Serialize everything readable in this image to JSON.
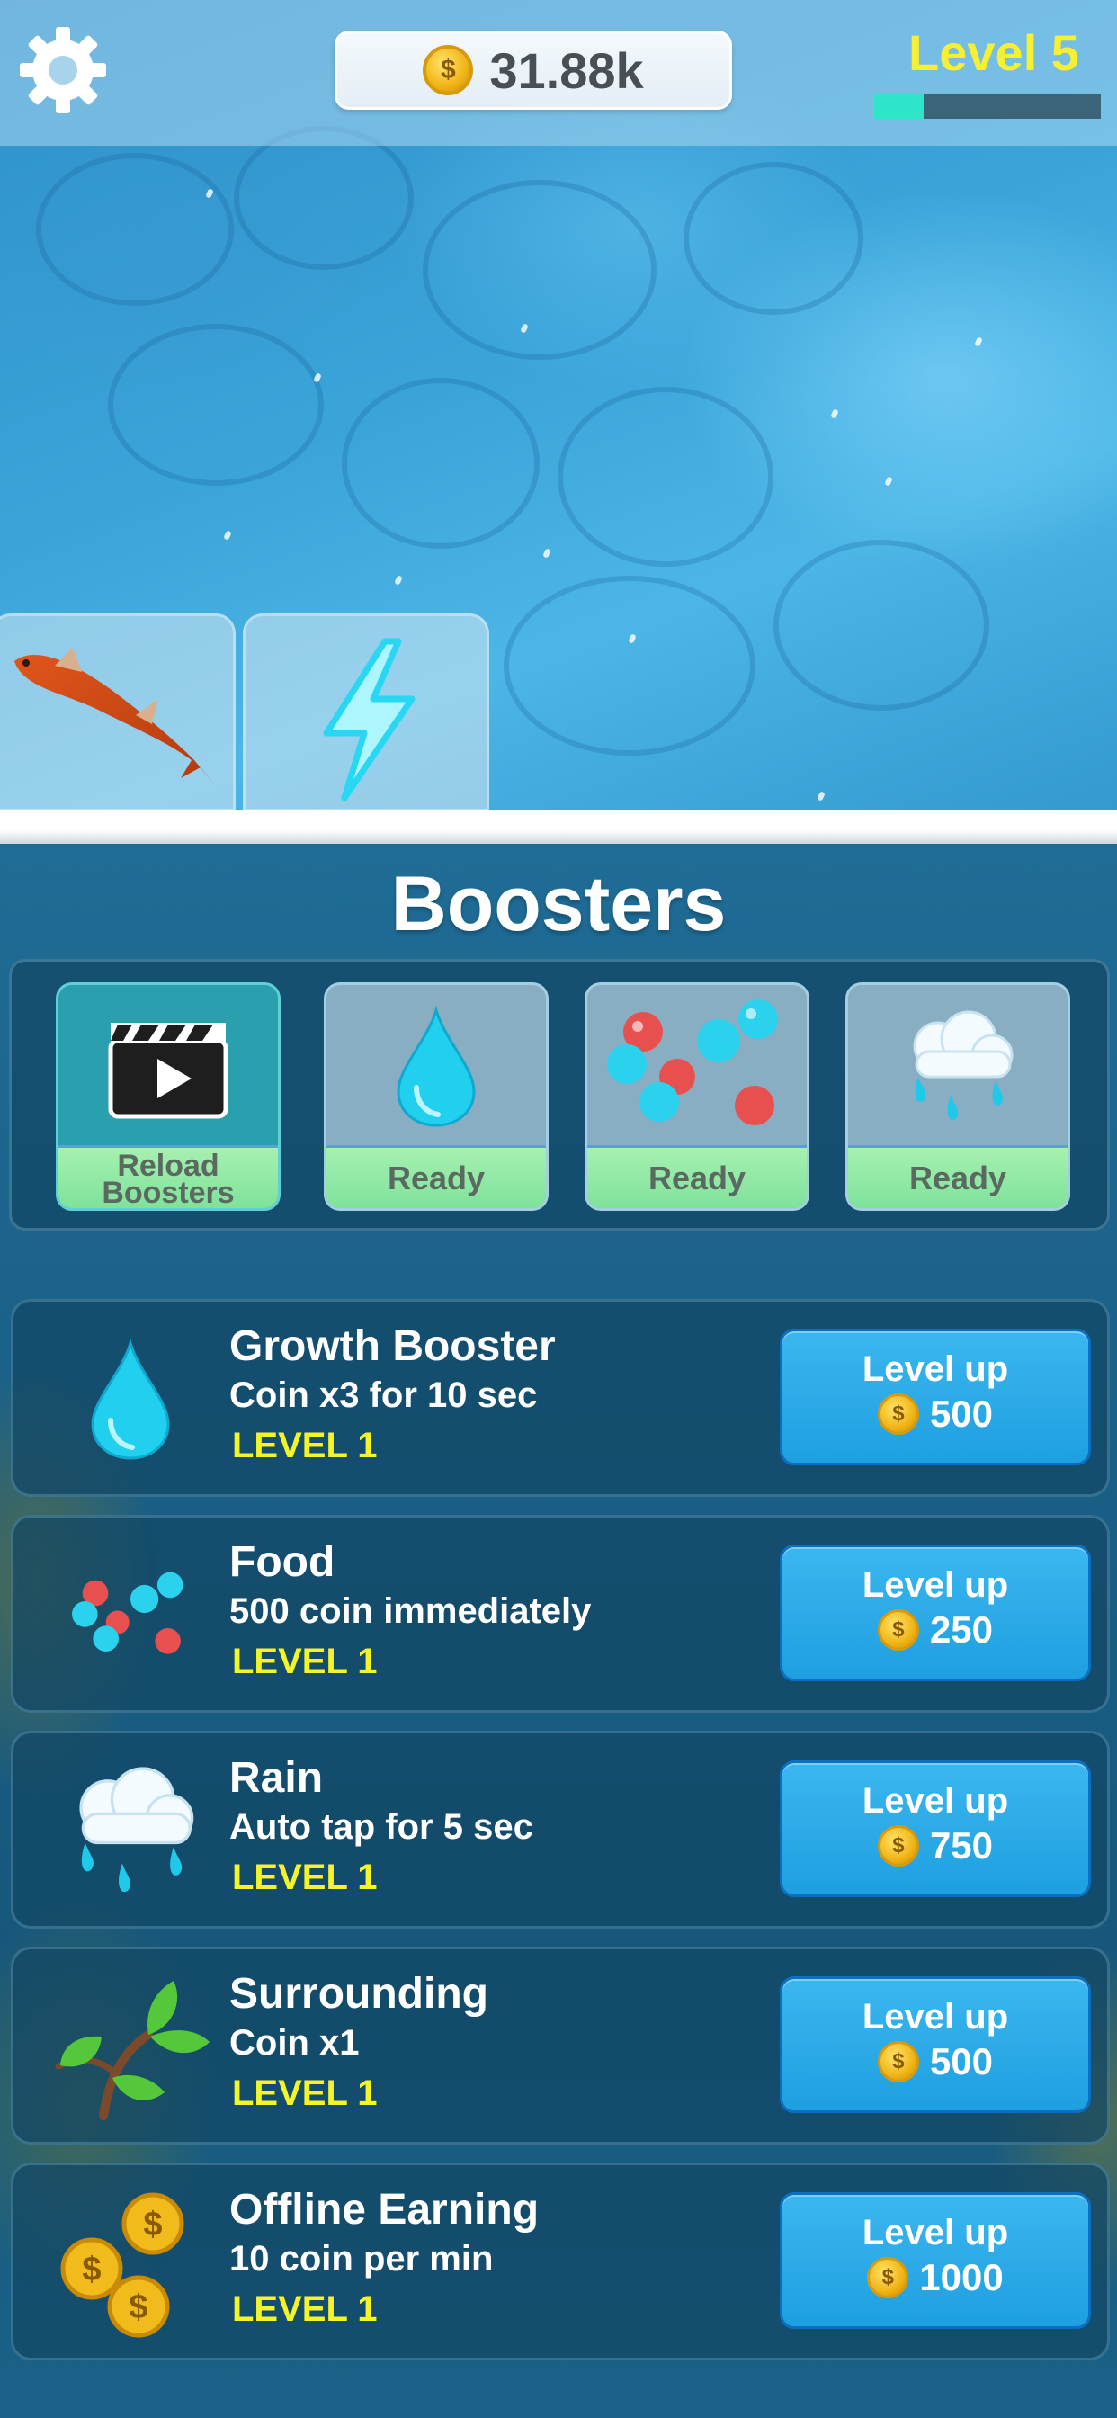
{
  "header": {
    "coins": "31.88k",
    "coin_symbol": "$",
    "level_label": "Level 5",
    "xp_progress_percent": 22
  },
  "pond_tabs": [
    {
      "name": "fish",
      "icon": "koi-fish-icon"
    },
    {
      "name": "boost",
      "icon": "lightning-icon"
    }
  ],
  "boosters": {
    "title": "Boosters",
    "cards": [
      {
        "id": "reload",
        "icon": "clapperboard-play-icon",
        "status_line1": "Reload",
        "status_line2": "Boosters"
      },
      {
        "id": "growth",
        "icon": "water-drop-icon",
        "status": "Ready"
      },
      {
        "id": "food",
        "icon": "food-pellets-icon",
        "status": "Ready"
      },
      {
        "id": "rain",
        "icon": "rain-cloud-icon",
        "status": "Ready"
      }
    ]
  },
  "upgrades": [
    {
      "icon": "water-drop-icon",
      "name": "Growth Booster",
      "desc": "Coin x3 for 10 sec",
      "level": "LEVEL 1",
      "button": "Level up",
      "price": "500"
    },
    {
      "icon": "food-pellets-icon",
      "name": "Food",
      "desc": "500 coin immediately",
      "level": "LEVEL 1",
      "button": "Level up",
      "price": "250"
    },
    {
      "icon": "rain-cloud-icon",
      "name": "Rain",
      "desc": "Auto tap for 5 sec",
      "level": "LEVEL 1",
      "button": "Level up",
      "price": "750"
    },
    {
      "icon": "plant-sprout-icon",
      "name": "Surrounding",
      "desc": "Coin x1",
      "level": "LEVEL 1",
      "button": "Level up",
      "price": "500"
    },
    {
      "icon": "coin-stack-icon",
      "name": "Offline Earning",
      "desc": "10 coin per min",
      "level": "LEVEL 1",
      "button": "Level up",
      "price": "1000"
    }
  ],
  "colors": {
    "level_yellow": "#f7f032",
    "xp_fill": "#2ee6c7",
    "button_blue": "#1e9fe0",
    "ready_green": "#7fe29a"
  }
}
